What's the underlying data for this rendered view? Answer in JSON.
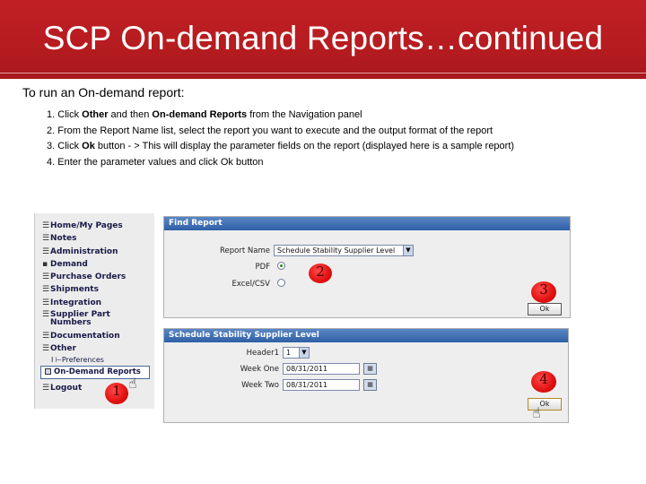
{
  "slide": {
    "title": "SCP On-demand Reports…continued",
    "intro": "To run an On-demand report:",
    "steps": [
      {
        "num": "1.",
        "pre": "Click ",
        "b1": "Other",
        "mid": " and then ",
        "b2": "On-demand Reports",
        "post": " from the Navigation panel"
      },
      {
        "num": "2.",
        "text": "From the Report Name list, select the report  you want to execute and the output format of the report"
      },
      {
        "num": "3.",
        "pre": "Click ",
        "b1": "Ok",
        "post": " button - > This will display the parameter fields on the report (displayed here is a sample report)"
      },
      {
        "num": "4.",
        "text": "Enter the parameter values and click Ok button"
      }
    ]
  },
  "nav": {
    "items": [
      {
        "label": "Home/My Pages",
        "bullet": "☰"
      },
      {
        "label": "Notes",
        "bullet": "☰"
      },
      {
        "label": "Administration",
        "bullet": "☰"
      },
      {
        "label": "Demand",
        "bullet": "▪"
      },
      {
        "label": "Purchase Orders",
        "bullet": "☰"
      },
      {
        "label": "Shipments",
        "bullet": "☰"
      },
      {
        "label": "Integration",
        "bullet": "☰"
      },
      {
        "label": "Supplier Part",
        "label2": "Numbers",
        "bullet": "☰"
      },
      {
        "label": "Documentation",
        "bullet": "☰"
      },
      {
        "label": "Other",
        "bullet": "☰"
      }
    ],
    "sub_preferences": "I ⊢Preferences",
    "on_demand": "On-Demand Reports",
    "logout": "Logout"
  },
  "find_report": {
    "header": "Find Report",
    "report_name_label": "Report Name",
    "report_name_value": "Schedule Stability Supplier Level",
    "pdf_label": "PDF",
    "excel_label": "Excel/CSV",
    "ok_label": "Ok"
  },
  "schedule": {
    "header": "Schedule Stability Supplier Level",
    "header1_label": "Header1",
    "header1_value": "1",
    "week_one_label": "Week One",
    "week_one_value": "08/31/2011",
    "week_two_label": "Week Two",
    "week_two_value": "08/31/2011",
    "ok_label": "Ok"
  },
  "markers": [
    "1",
    "2",
    "3",
    "4"
  ],
  "colors": {
    "header_red": "#b71c20",
    "panel_blue": "#2f5fa6",
    "marker_red": "#e01010"
  }
}
